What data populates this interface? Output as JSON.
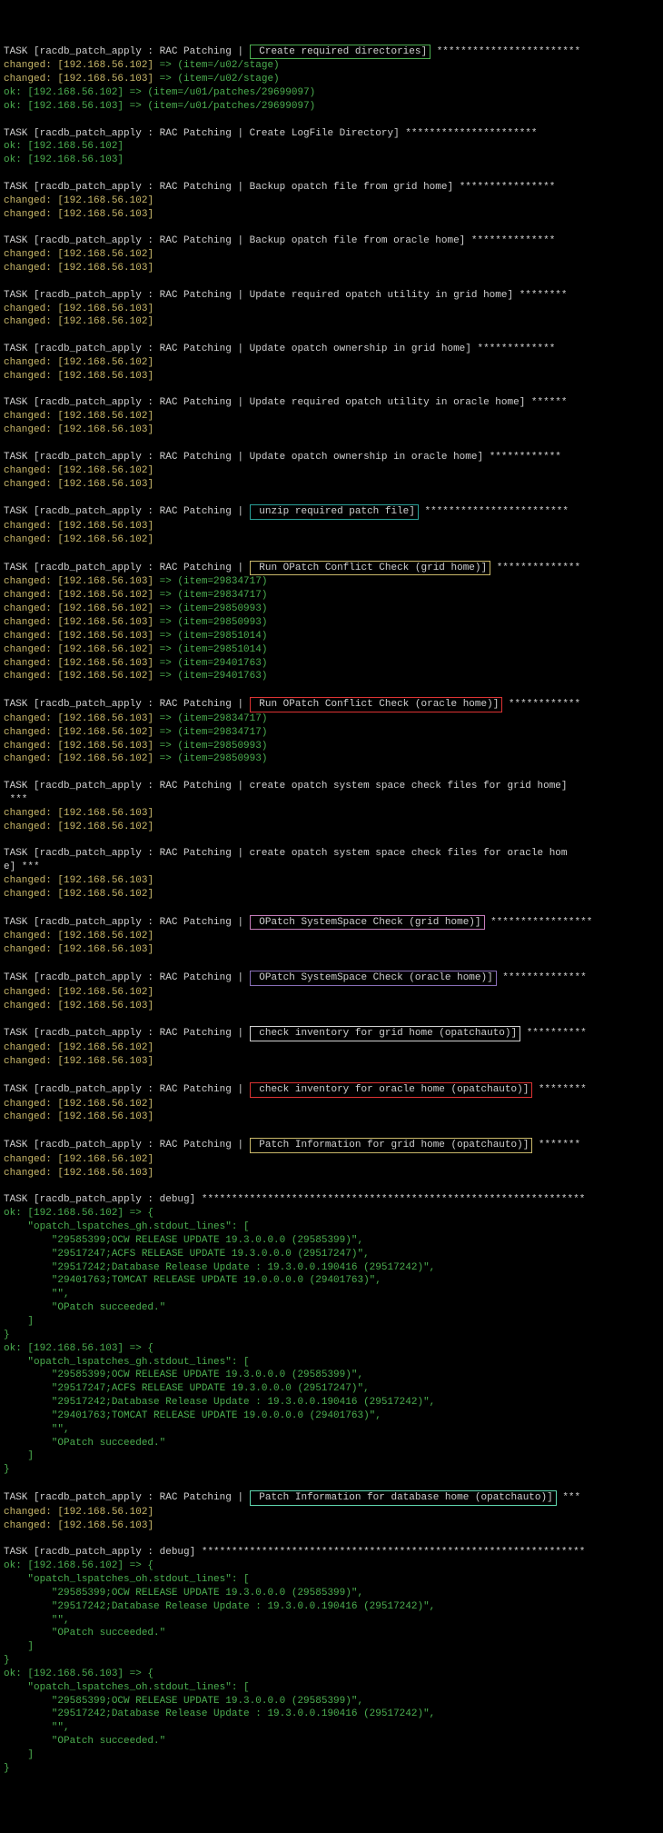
{
  "hosts": {
    "h102": "[192.168.56.102]",
    "h103": "[192.168.56.103]"
  },
  "role_prefix": "TASK [racdb_patch_apply : RAC Patching | ",
  "labels": {
    "create_dirs": "Create required directories]",
    "create_log": "Create LogFile Directory]",
    "backup_grid": "Backup opatch file from grid home]",
    "backup_oracle": "Backup opatch file from oracle home]",
    "upd_util_grid": "Update required opatch utility in grid home]",
    "upd_own_grid": "Update opatch ownership in grid home]",
    "upd_util_oracle": "Update required opatch utility in oracle home]",
    "upd_own_oracle": "Update opatch ownership in oracle home]",
    "unzip": "unzip required patch file]",
    "conflict_grid": "Run OPatch Conflict Check (grid home)]",
    "conflict_oracle": "Run OPatch Conflict Check (oracle home)]",
    "space_grid_file": "create opatch system space check files for grid home]",
    "space_oracle_file": "create opatch system space check files for oracle hom",
    "space_oracle_file_cont": "e] ***",
    "space_grid": "OPatch SystemSpace Check (grid home)]",
    "space_oracle": "OPatch SystemSpace Check (oracle home)]",
    "inv_grid": "check inventory for grid home (opatchauto)]",
    "inv_oracle": "check inventory for oracle home (opatchauto)]",
    "pinfo_grid": "Patch Information for grid home (opatchauto)]",
    "pinfo_db": "Patch Information for database home (opatchauto)]",
    "debug": "TASK [racdb_patch_apply : debug] "
  },
  "items": {
    "stage_u02": " => (item=/u02/stage)",
    "patches": " => (item=/u01/patches/29699097)",
    "p29834717": " => (item=29834717)",
    "p29850993": " => (item=29850993)",
    "p29851014": " => (item=29851014)",
    "p29401763": " => (item=29401763)"
  },
  "debug_header_gh": "    \"opatch_lspatches_gh.stdout_lines\": [",
  "debug_header_oh": "    \"opatch_lspatches_oh.stdout_lines\": [",
  "gh_lines": [
    "        \"29585399;OCW RELEASE UPDATE 19.3.0.0.0 (29585399)\",",
    "        \"29517247;ACFS RELEASE UPDATE 19.3.0.0.0 (29517247)\",",
    "        \"29517242;Database Release Update : 19.3.0.0.190416 (29517242)\",",
    "        \"29401763;TOMCAT RELEASE UPDATE 19.0.0.0.0 (29401763)\",",
    "        \"\",",
    "        \"OPatch succeeded.\""
  ],
  "oh_lines": [
    "        \"29585399;OCW RELEASE UPDATE 19.3.0.0.0 (29585399)\",",
    "        \"29517242;Database Release Update : 19.3.0.0.190416 (29517242)\",",
    "        \"\",",
    "        \"OPatch succeeded.\""
  ],
  "close_bracket": "    ]",
  "close_brace": "}",
  "arrow_brace": " => {",
  "pad_stars_grid_file": " ***",
  "stars": {
    "s1": "************************",
    "s2": "**********************",
    "s3": "****************",
    "s4": "**************",
    "s5": "********",
    "s6": "*************",
    "s7": "******",
    "s8": "************",
    "s9": "************************",
    "s10": "*****************************",
    "s11": "*******",
    "s12": "*****************",
    "s13": "**********",
    "s14": "*******",
    "s15": "***"
  }
}
